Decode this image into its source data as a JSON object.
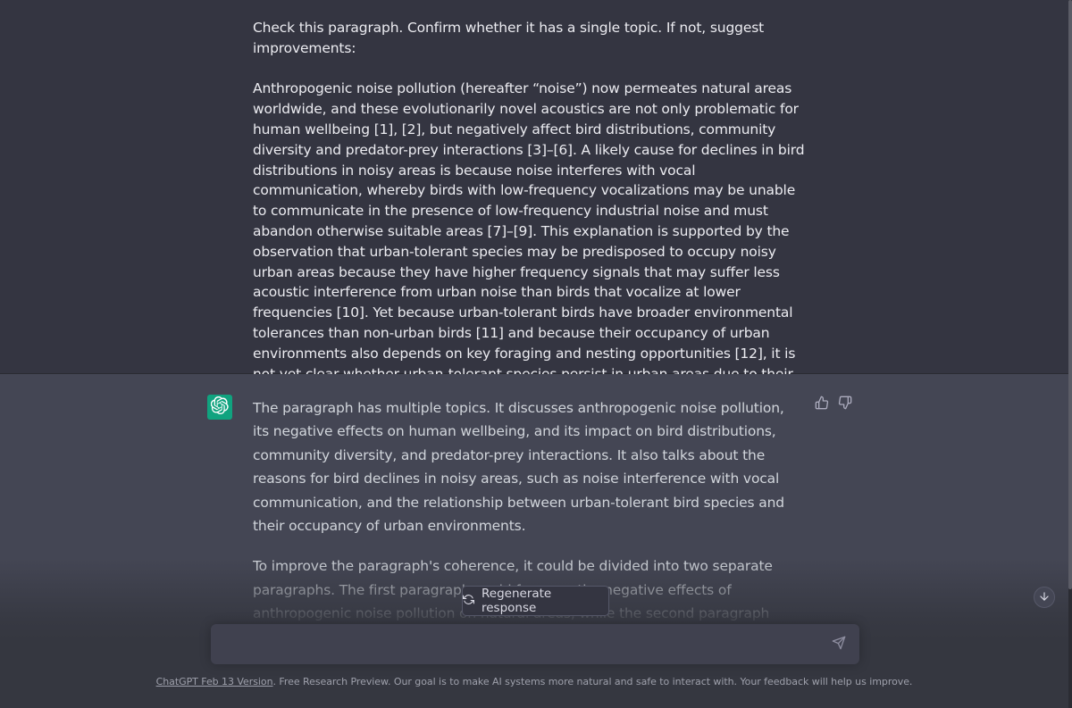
{
  "user_message": {
    "prompt": "Check this paragraph. Confirm whether it has a single topic. If not, suggest improvements:",
    "paragraph": "Anthropogenic noise pollution (hereafter “noise”) now permeates natural areas worldwide, and these evolutionarily novel acoustics are not only problematic for human wellbeing [1], [2], but negatively affect bird distributions, community diversity and predator-prey interactions [3]–[6]. A likely cause for declines in bird distributions in noisy areas is because noise interferes with vocal communication, whereby birds with low-frequency vocalizations may be unable to communicate in the presence of low-frequency industrial noise and must abandon otherwise suitable areas [7]–[9]. This explanation is supported by the observation that urban-tolerant species may be predisposed to occupy noisy urban areas because they have higher frequency signals that may suffer less acoustic interference from urban noise than birds that vocalize at lower frequencies [10]. Yet because urban-tolerant birds have broader environmental tolerances than non-urban birds [11] and because their occupancy of urban environments also depends on key foraging and nesting opportunities [12], it is not yet clear whether urban-tolerant species persist in urban areas due to their signaling characteristics or because of other factors."
  },
  "assistant_message": {
    "paragraphs": [
      "The paragraph has multiple topics. It discusses anthropogenic noise pollution, its negative effects on human wellbeing, and its impact on bird distributions, community diversity, and predator-prey interactions. It also talks about the reasons for bird declines in noisy areas, such as noise interference with vocal communication, and the relationship between urban-tolerant bird species and their occupancy of urban environments.",
      "To improve the paragraph's coherence, it could be divided into two separate paragraphs. The first paragraph could focus on the negative effects of anthropogenic noise pollution on natural areas, while the second paragraph could discuss the reasons for bird declines in noisy areas and the relationship between urban-tolerant bird species and their occupancy of"
    ]
  },
  "actions": {
    "regenerate_label": "Regenerate response"
  },
  "composer": {
    "placeholder": ""
  },
  "footer": {
    "version_link": "ChatGPT Feb 13 Version",
    "text": ". Free Research Preview. Our goal is to make AI systems more natural and safe to interact with. Your feedback will help us improve."
  },
  "icons": {
    "avatar": "openai-logo-icon",
    "thumbs_up": "thumbs-up-icon",
    "thumbs_down": "thumbs-down-icon",
    "regenerate": "refresh-icon",
    "send": "send-icon",
    "scroll_down": "arrow-down-icon"
  },
  "colors": {
    "user_bg": "#343541",
    "assistant_bg": "#444654",
    "avatar_bg": "#10a37f",
    "input_bg": "#40414f"
  }
}
